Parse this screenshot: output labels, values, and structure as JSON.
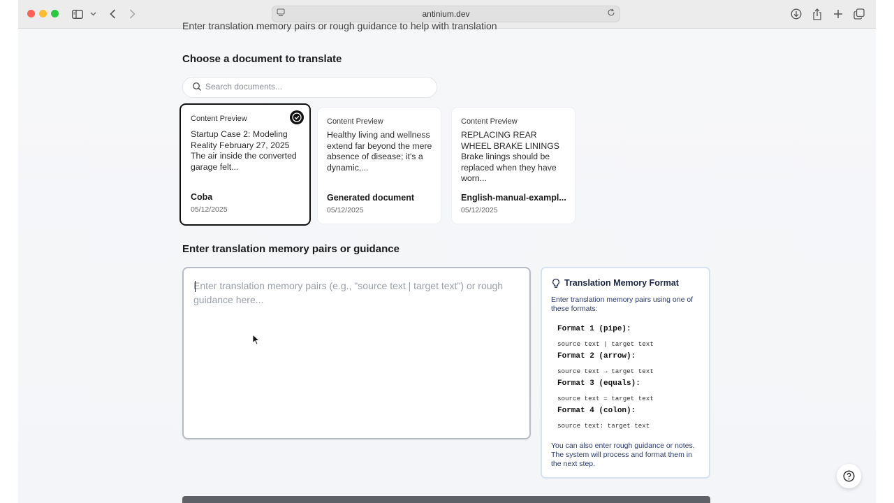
{
  "browser": {
    "url": "antinium.dev"
  },
  "page": {
    "cut_off_text": "Enter translation memory pairs or rough guidance to help with translation",
    "choose_heading": "Choose a document to translate",
    "search_placeholder": "Search documents...",
    "documents": [
      {
        "preview_label": "Content Preview",
        "preview": "Startup Case 2: Modeling Reality February 27, 2025 The air inside the converted garage felt...",
        "name": "Coba",
        "date": "05/12/2025",
        "selected": true
      },
      {
        "preview_label": "Content Preview",
        "preview": "Healthy living and wellness extend far beyond the mere absence of disease; it's a dynamic,...",
        "name": "Generated document",
        "date": "05/12/2025",
        "selected": false
      },
      {
        "preview_label": "Content Preview",
        "preview": "REPLACING REAR WHEEL BRAKE LININGS Brake linings should be replaced when they have worn...",
        "name": "English-manual-exampl...",
        "date": "05/12/2025",
        "selected": false
      }
    ],
    "tm_heading": "Enter translation memory pairs or guidance",
    "tm_placeholder": "Enter translation memory pairs (e.g., \"source text | target text\") or rough guidance here...",
    "format_box": {
      "title": "Translation Memory Format",
      "intro": "Enter translation memory pairs using one of these formats:",
      "formats": [
        {
          "label": "Format 1 (pipe):",
          "example": "source text | target text"
        },
        {
          "label": "Format 2 (arrow):",
          "example": "source text → target text"
        },
        {
          "label": "Format 3 (equals):",
          "example": "source text = target text"
        },
        {
          "label": "Format 4 (colon):",
          "example": "source text: target text"
        }
      ],
      "footer": "You can also enter rough guidance or notes. The system will process and format them in the next step."
    }
  }
}
